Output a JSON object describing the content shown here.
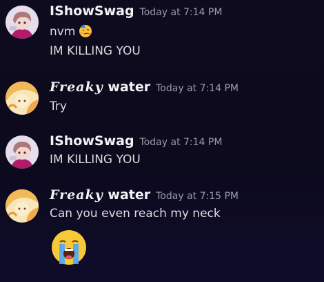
{
  "messages": [
    {
      "author": "IShowSwag",
      "timestamp": "Today at 7:14 PM",
      "lines": [
        "nvm",
        "IM KILLING YOU"
      ],
      "inline_emoji": "party-face-emoji"
    },
    {
      "author_styled": "Freaky",
      "author_plain": "water",
      "timestamp": "Today at 7:14 PM",
      "lines": [
        "Try"
      ]
    },
    {
      "author": "IShowSwag",
      "timestamp": "Today at 7:14 PM",
      "lines": [
        "IM KILLING YOU"
      ]
    },
    {
      "author_styled": "Freaky",
      "author_plain": "water",
      "timestamp": "Today at 7:15 PM",
      "lines": [
        "Can you even reach my neck"
      ],
      "big_emoji": "loudly-crying-face-emoji"
    }
  ],
  "colors": {
    "background": "#0d0b1d",
    "username": "#f2f3f5",
    "timestamp": "#9a9cad",
    "message_text": "#dbdee1"
  }
}
